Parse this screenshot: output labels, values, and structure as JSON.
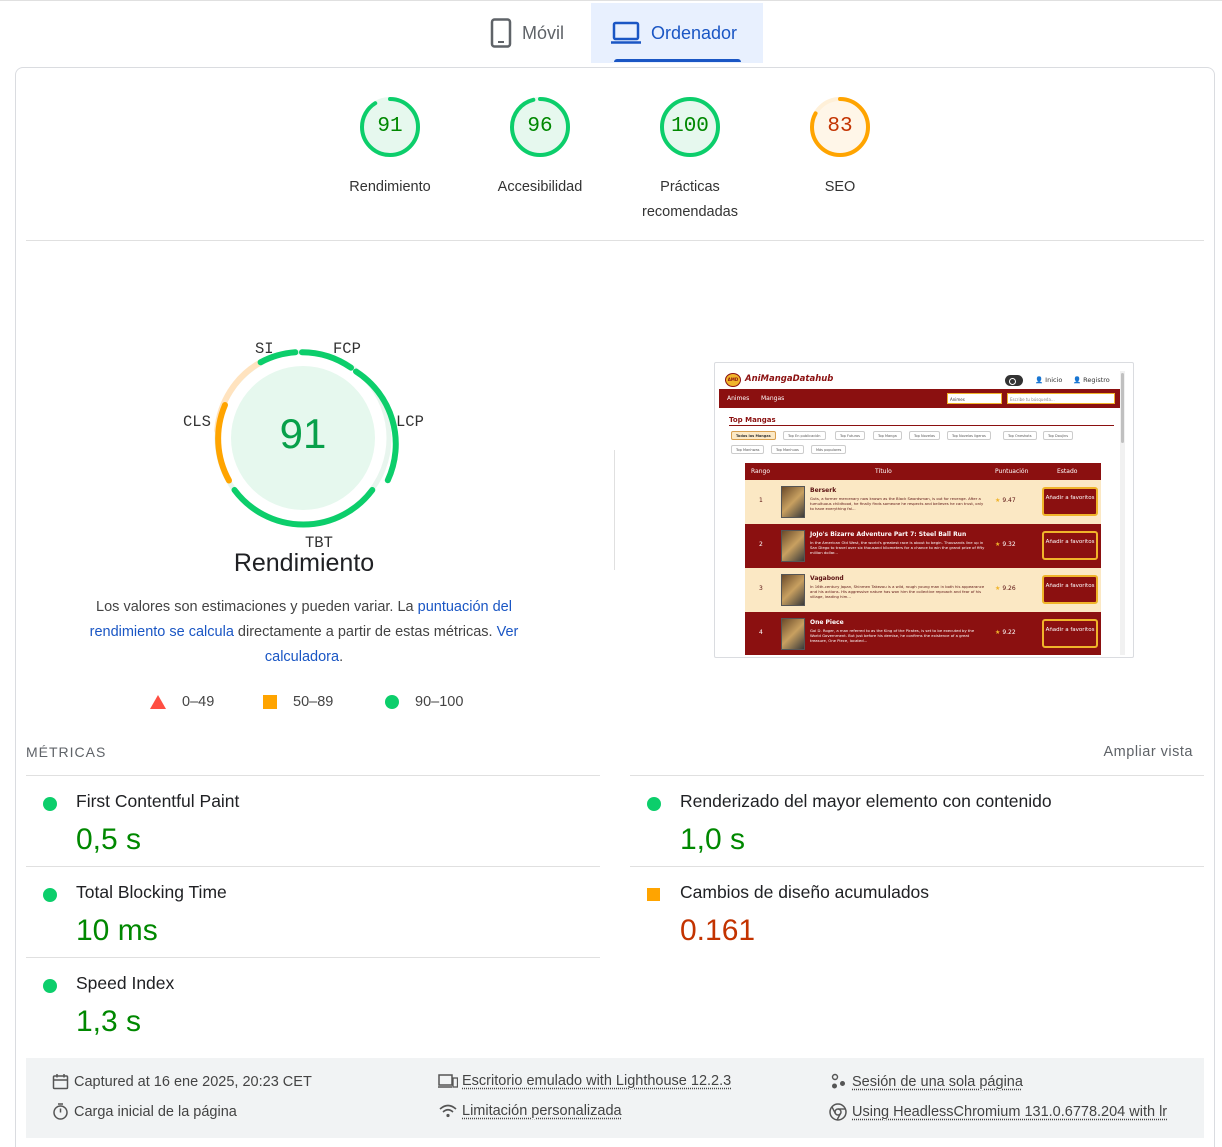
{
  "tabs": [
    {
      "label": "Móvil",
      "icon": "smartphone-icon"
    },
    {
      "label": "Ordenador",
      "icon": "laptop-icon"
    }
  ],
  "colors": {
    "pass": "#0cce6b",
    "average": "#ffa400",
    "fail": "#ff4e42",
    "pass_text": "#008800",
    "average_text": "#c33300",
    "link": "#1a56c4"
  },
  "categories": [
    {
      "score": "91",
      "label": "Rendimiento",
      "rating": "pass"
    },
    {
      "score": "96",
      "label": "Accesibilidad",
      "rating": "pass"
    },
    {
      "score": "100",
      "label": "Prácticas recomendadas",
      "rating": "pass"
    },
    {
      "score": "83",
      "label": "SEO",
      "rating": "average"
    }
  ],
  "performance": {
    "score": "91",
    "title": "Rendimiento",
    "gauge_labels": {
      "si": "SI",
      "fcp": "FCP",
      "lcp": "LCP",
      "tbt": "TBT",
      "cls": "CLS"
    },
    "desc_1": "Los valores son estimaciones y pueden variar. La ",
    "desc_link_1": "puntuación del rendimiento se calcula",
    "desc_2": " directamente a partir de estas métricas. ",
    "desc_link_2": "Ver calculadora",
    "desc_3": "."
  },
  "legend": [
    {
      "range": "0–49",
      "shape": "triangle"
    },
    {
      "range": "50–89",
      "shape": "square"
    },
    {
      "range": "90–100",
      "shape": "circle"
    }
  ],
  "screenshot": {
    "brand": "AniMangaDatahub",
    "logo_text": "AMD",
    "user_links": [
      "Inicio",
      "Registro"
    ],
    "nav": [
      "Animes",
      "Mangas"
    ],
    "select_value": "Animes",
    "search_placeholder": "Escribe tu búsqueda...",
    "section_title": "Top Mangas",
    "chips": [
      "Todos los Mangas",
      "Top En publicación",
      "Top Futuros",
      "Top Manga",
      "Top Novelas",
      "Top Novelas ligeras",
      "Top Oneshots",
      "Top Doujins",
      "Top Manhwas",
      "Top Manhuas",
      "Más populares"
    ],
    "columns": [
      "Rango",
      "Título",
      "Puntuación",
      "Estado"
    ],
    "button": "Añadir a favoritos",
    "rows": [
      {
        "rank": "1",
        "title": "Berserk",
        "desc": "Guts, a former mercenary now known as the Black Swordsman, is out for revenge. After a tumultuous childhood, he finally finds someone he respects and believes he can trust, only to have everything fal...",
        "score": "9.47"
      },
      {
        "rank": "2",
        "title": "JoJo's Bizarre Adventure Part 7: Steel Ball Run",
        "desc": "In the American Old West, the world's greatest race is about to begin. Thousands line up in San Diego to travel over six thousand kilometers for a chance to win the grand prize of fifty million dollar...",
        "score": "9.32"
      },
      {
        "rank": "3",
        "title": "Vagabond",
        "desc": "In 16th-century Japan, Shinmen Takezou is a wild, rough young man in both his appearance and his actions. His aggressive nature has won him the collective reproach and fear of his village, leading him...",
        "score": "9.26"
      },
      {
        "rank": "4",
        "title": "One Piece",
        "desc": "Gol D. Roger, a man referred to as the King of the Pirates, is set to be executed by the World Government. But just before his demise, he confirms the existence of a great treasure, One Piece, located...",
        "score": "9.22"
      }
    ]
  },
  "metrics_header": "MÉTRICAS",
  "expand_view": "Ampliar vista",
  "metrics": [
    {
      "name": "First Contentful Paint",
      "value": "0,5 s",
      "rating": "pass"
    },
    {
      "name": "Renderizado del mayor elemento con contenido",
      "value": "1,0 s",
      "rating": "pass"
    },
    {
      "name": "Total Blocking Time",
      "value": "10 ms",
      "rating": "pass"
    },
    {
      "name": "Cambios de diseño acumulados",
      "value": "0.161",
      "rating": "average"
    },
    {
      "name": "Speed Index",
      "value": "1,3 s",
      "rating": "pass"
    }
  ],
  "footer": {
    "captured": "Captured at 16 ene 2025, 20:23 CET",
    "initial_load": "Carga inicial de la página",
    "device": "Escritorio emulado with Lighthouse 12.2.3",
    "throttling": "Limitación personalizada",
    "session": "Sesión de una sola página",
    "browser": "Using HeadlessChromium 131.0.6778.204 with lr"
  }
}
